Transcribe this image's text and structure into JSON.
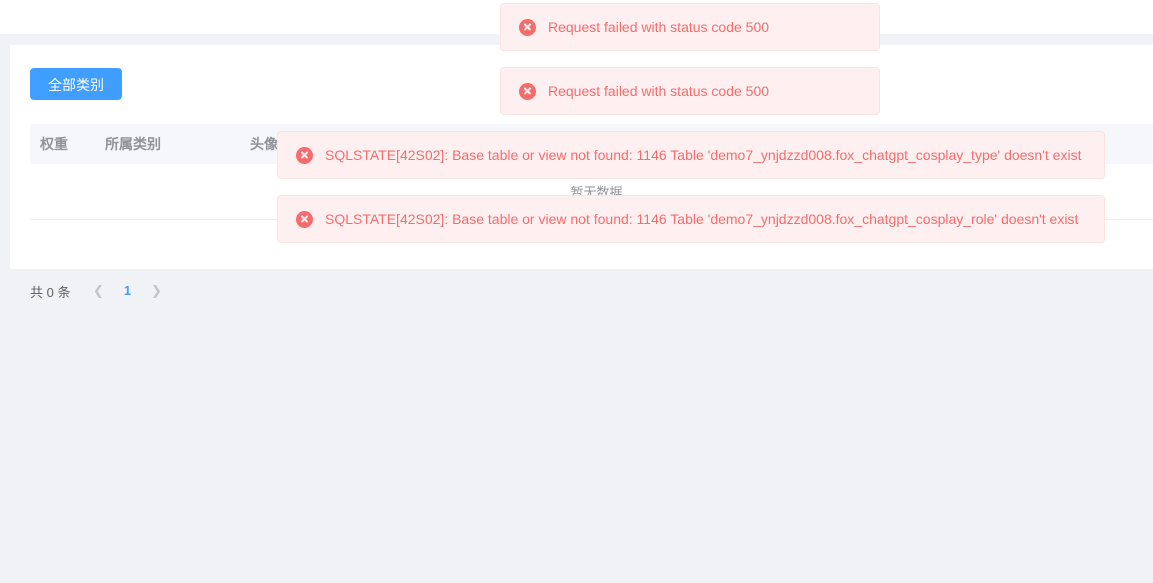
{
  "page": {
    "background_color": "#f0f2f5",
    "card_background": "#ffffff"
  },
  "toolbar": {
    "all_category_button": "全部类别"
  },
  "table": {
    "columns": [
      {
        "key": "weight",
        "label": "权重"
      },
      {
        "key": "category",
        "label": "所属类别"
      },
      {
        "key": "avatar",
        "label": "头像"
      },
      {
        "key": "name",
        "label": ""
      },
      {
        "key": "desc",
        "label": ""
      },
      {
        "key": "status",
        "label": ""
      },
      {
        "key": "actions",
        "label": ""
      }
    ],
    "rows": [],
    "empty_text": "暂无数据"
  },
  "pagination": {
    "total_label": "共 0 条",
    "prev_icon": "chevron-left-icon",
    "current_page": "1",
    "next_icon": "chevron-right-icon"
  },
  "toasts": [
    {
      "id": "toast-0",
      "type": "error",
      "icon": "error-circle-icon",
      "message": "Request failed with status code 500"
    },
    {
      "id": "toast-1",
      "type": "error",
      "icon": "error-circle-icon",
      "message": "Request failed with status code 500"
    },
    {
      "id": "toast-2",
      "type": "error",
      "icon": "error-circle-icon",
      "message": "SQLSTATE[42S02]: Base table or view not found: 1146 Table 'demo7_ynjdzzd008.fox_chatgpt_cosplay_type' doesn't exist"
    },
    {
      "id": "toast-3",
      "type": "error",
      "icon": "error-circle-icon",
      "message": "SQLSTATE[42S02]: Base table or view not found: 1146 Table 'demo7_ynjdzzd008.fox_chatgpt_cosplay_role' doesn't exist"
    }
  ],
  "colors": {
    "primary": "#409eff",
    "error_text": "#f56c6c",
    "error_bg": "#fef0f0",
    "error_border": "#fde2e2",
    "table_header_bg": "#f5f7fa",
    "muted_text": "#909399"
  }
}
